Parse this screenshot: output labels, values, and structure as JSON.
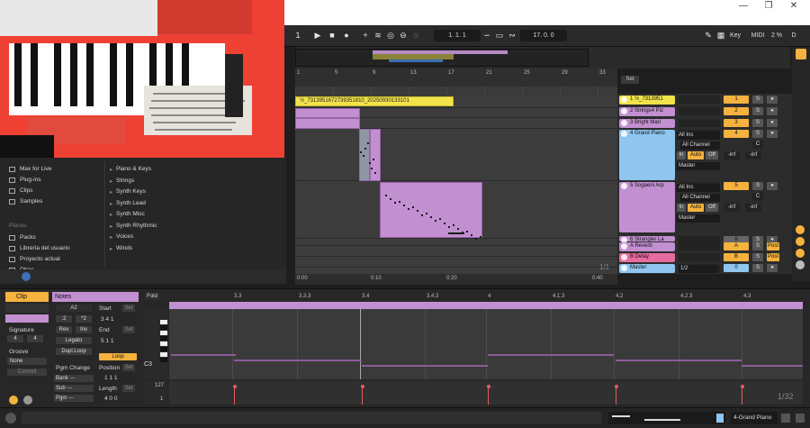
{
  "colors": {
    "accent": "#f5b23e",
    "clip": "#c28fd1",
    "red": "#ef4034",
    "blue": "#8fc5ef"
  },
  "transport": {
    "bar_left": "1",
    "position": "1.  1.  1",
    "loop_len": "17.  0.  0",
    "key_label": "Key",
    "midi_label": "MIDI",
    "cpu": "2 %",
    "d_label": "D"
  },
  "arrangement": {
    "ruler_ticks": [
      "1",
      "5",
      "9",
      "13",
      "17",
      "21",
      "25",
      "29",
      "33"
    ],
    "clip_name": "½_7313951672739351810_20250930133101",
    "time_ticks": [
      "0:00",
      "0:10",
      "0:20",
      "0:40"
    ],
    "zoom": "1/1",
    "set_label": "Set"
  },
  "mixer": {
    "tracks": [
      {
        "name": "1 ½_7313951",
        "num": "1",
        "color": "#f2e34b"
      },
      {
        "name": "2 Strings4 Piz",
        "num": "2",
        "color": "#c28fd1"
      },
      {
        "name": "3 Bright Mari",
        "num": "3",
        "color": "#c28fd1"
      },
      {
        "name": "4 Grand Piano",
        "num": "4",
        "color": "#8fc5ef"
      },
      {
        "name": "5 Sogaeni Arp",
        "num": "5",
        "color": "#c28fd1"
      },
      {
        "name": "6 Strangler La",
        "num": "6",
        "color": "#c28fd1"
      },
      {
        "name": "A Reverb",
        "num": "A",
        "color": "#c28fd1"
      },
      {
        "name": "B Delay",
        "num": "B",
        "color": "#e86b9f"
      },
      {
        "name": "Master",
        "num": "0",
        "color": "#8fc5ef"
      }
    ],
    "all_ins": "All Ins",
    "all_channels": "All Channel",
    "in": "In",
    "auto": "Auto",
    "off": "Off",
    "inf": "-inf",
    "master": "Master",
    "s": "S",
    "c": "C",
    "post": "Post",
    "master_sel": "1/2"
  },
  "browser": {
    "left": [
      "Max for Live",
      "Plug-ins",
      "Clips",
      "Samples"
    ],
    "places_label": "Places",
    "places": [
      "Packs",
      "Librería del usuario",
      "Proyecto actual",
      "Otras"
    ],
    "right": [
      "Piano & Keys",
      "Strings",
      "Synth Keys",
      "Synth Lead",
      "Synth Misc",
      "Synth Rhythmic",
      "Voices",
      "Winds"
    ]
  },
  "clip_panel": {
    "clip_tab": "Clip",
    "notes_tab": "Notes",
    "signature_label": "Signature",
    "sig_num": "4",
    "sig_den": "4",
    "groove_label": "Groove",
    "groove_value": "None",
    "commit": "Commit",
    "note": "A2",
    "div2": ":2",
    "mul2": "*2",
    "rev": "Rev",
    "inv": "Inv",
    "legato": "Legato",
    "dupl": "Dupl.Loop",
    "start_label": "Start",
    "start_val": "3 4 1",
    "end_label": "End",
    "end_val": "5 1 1",
    "set": "Set",
    "loop": "Loop",
    "pgm_change": "Pgm Change",
    "position_label": "Position",
    "bank": "Bank ---",
    "sub": "Sub ---",
    "pgm": "Pgm ---",
    "pos_val": "1  1  1",
    "length_label": "Length",
    "length_val": "4  0  0",
    "fold": "Fold"
  },
  "editor": {
    "ticks": [
      "3.3",
      "3.3.3",
      "3.4",
      "3.4.3",
      "4",
      "4.1.3",
      "4.2",
      "4.2.3",
      "4.3"
    ],
    "c3": "C3",
    "vel_max": "127",
    "vel_min": "1",
    "zoom": "1/32"
  },
  "status": {
    "track_name": "4-Grand Piano"
  }
}
